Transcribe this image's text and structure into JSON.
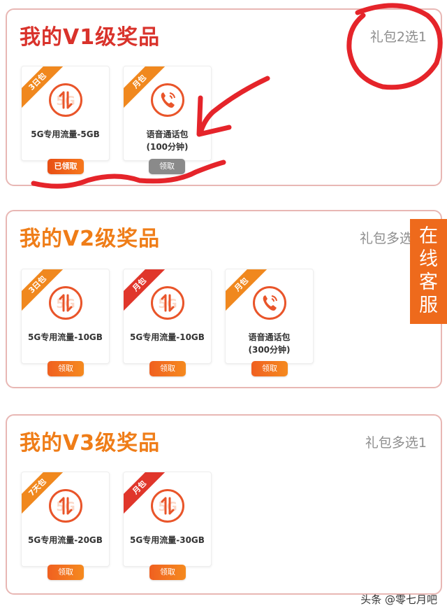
{
  "sections": [
    {
      "title": "我的V1级奖品",
      "note": "礼包2选1",
      "title_color": "#d9322b",
      "cards": [
        {
          "tag": "3日包",
          "tag_color": "orange",
          "icon": "data-5g-icon",
          "label": "5G专用流量-5GB",
          "button": "已领取",
          "button_state": "claimed"
        },
        {
          "tag": "月包",
          "tag_color": "orange",
          "icon": "phone-call-icon",
          "label": "语音通话包\n(100分钟)",
          "button": "领取",
          "button_state": "disabled"
        }
      ]
    },
    {
      "title": "我的V2级奖品",
      "note": "礼包多选",
      "title_color": "#ef7d18",
      "cards": [
        {
          "tag": "3日包",
          "tag_color": "orange",
          "icon": "data-5g-icon",
          "label": "5G专用流量-10GB",
          "button": "领取",
          "button_state": "active"
        },
        {
          "tag": "月包",
          "tag_color": "red",
          "icon": "data-5g-icon",
          "label": "5G专用流量-10GB",
          "button": "领取",
          "button_state": "active"
        },
        {
          "tag": "月包",
          "tag_color": "orange",
          "icon": "phone-call-icon",
          "label": "语音通话包\n(300分钟)",
          "button": "领取",
          "button_state": "active"
        }
      ]
    },
    {
      "title": "我的V3级奖品",
      "note": "礼包多选1",
      "title_color": "#ef7d18",
      "cards": [
        {
          "tag": "7天包",
          "tag_color": "orange",
          "icon": "data-5g-icon",
          "label": "5G专用流量-20GB",
          "button": "领取",
          "button_state": "active"
        },
        {
          "tag": "月包",
          "tag_color": "red",
          "icon": "data-5g-icon",
          "label": "5G专用流量-30GB",
          "button": "领取",
          "button_state": "active"
        }
      ]
    }
  ],
  "side_button": "在线客服",
  "watermark": "头条 @零七月吧",
  "annotation_color": "#e5242a"
}
